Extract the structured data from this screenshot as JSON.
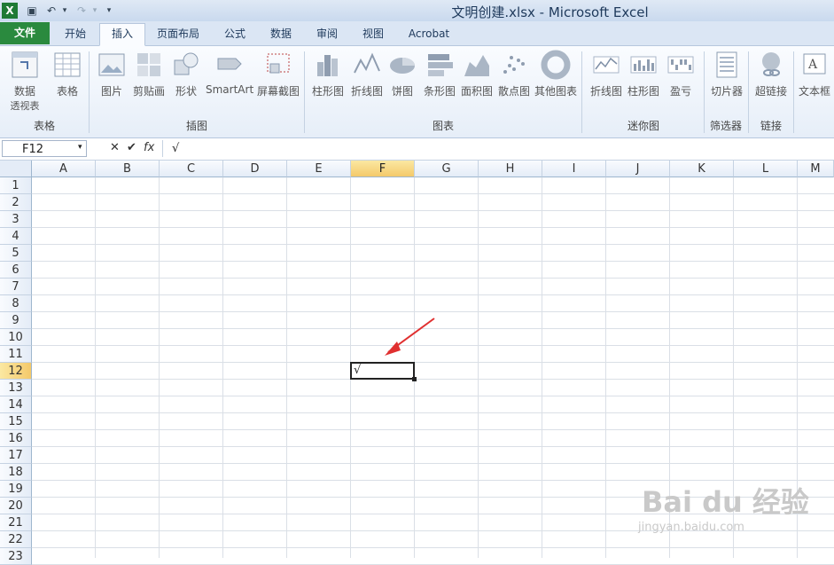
{
  "window": {
    "title": "文明创建.xlsx - Microsoft Excel"
  },
  "tabs": [
    {
      "label": "文件"
    },
    {
      "label": "开始"
    },
    {
      "label": "插入"
    },
    {
      "label": "页面布局"
    },
    {
      "label": "公式"
    },
    {
      "label": "数据"
    },
    {
      "label": "审阅"
    },
    {
      "label": "视图"
    },
    {
      "label": "Acrobat"
    }
  ],
  "ribbon": {
    "buttons": [
      {
        "label": "数据",
        "sub": "透视表"
      },
      {
        "label": "表格"
      },
      {
        "label": "图片"
      },
      {
        "label": "剪贴画"
      },
      {
        "label": "形状"
      },
      {
        "label": "SmartArt"
      },
      {
        "label": "屏幕截图"
      },
      {
        "label": "柱形图"
      },
      {
        "label": "折线图"
      },
      {
        "label": "饼图"
      },
      {
        "label": "条形图"
      },
      {
        "label": "面积图"
      },
      {
        "label": "散点图"
      },
      {
        "label": "其他图表"
      },
      {
        "label": "折线图"
      },
      {
        "label": "柱形图"
      },
      {
        "label": "盈亏"
      },
      {
        "label": "切片器"
      },
      {
        "label": "超链接"
      },
      {
        "label": "文本框"
      }
    ],
    "groups": [
      "表格",
      "插图",
      "图表",
      "迷你图",
      "筛选器",
      "链接"
    ]
  },
  "formula_bar": {
    "name_box": "F12",
    "x": "✕",
    "ok": "✔",
    "fx": "fx",
    "content": "√"
  },
  "sheet": {
    "columns": [
      "A",
      "B",
      "C",
      "D",
      "E",
      "F",
      "G",
      "H",
      "I",
      "J",
      "K",
      "L",
      "M"
    ],
    "rows": [
      "1",
      "2",
      "3",
      "4",
      "5",
      "6",
      "7",
      "8",
      "9",
      "10",
      "11",
      "12",
      "13",
      "14",
      "15",
      "16",
      "17",
      "18",
      "19",
      "20",
      "21",
      "22",
      "23"
    ],
    "selected_column": "F",
    "selected_row": "12",
    "active_cell_value": "√"
  },
  "watermark": {
    "text": "Bai du 经验",
    "sub": "jingyan.baidu.com"
  }
}
